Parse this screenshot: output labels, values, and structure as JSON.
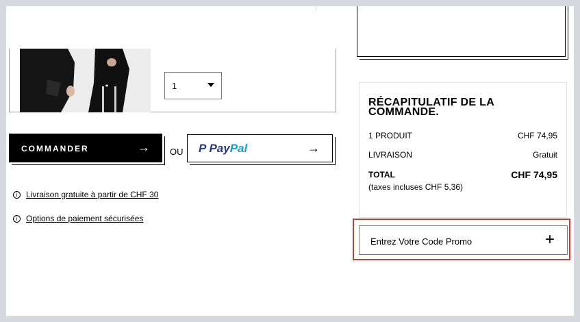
{
  "product": {
    "image_alt": "product-photo",
    "quantity": "1"
  },
  "actions": {
    "commander_label": "COMMANDER",
    "or_label": "OU",
    "paypal_pay": "Pay",
    "paypal_pal": "Pal",
    "arrow": "→"
  },
  "info": {
    "free_shipping": "Livraison gratuite à partir de CHF 30",
    "secure_payment": "Options de paiement sécurisées",
    "icon_glyph": "i"
  },
  "summary": {
    "title": "RÉCAPITULATIF DE LA COMMANDE.",
    "rows": [
      {
        "label": "1 PRODUIT",
        "value": "CHF 74,95"
      },
      {
        "label": "LIVRAISON",
        "value": "Gratuit"
      }
    ],
    "total_label": "TOTAL",
    "total_value": "CHF 74,95",
    "taxes": "(taxes incluses  CHF 5,36)"
  },
  "promo": {
    "label": "Entrez Votre Code Promo",
    "plus": "+"
  },
  "colors": {
    "highlight": "#e0321f",
    "paypal_dark": "#253b80",
    "paypal_light": "#179bd7"
  }
}
